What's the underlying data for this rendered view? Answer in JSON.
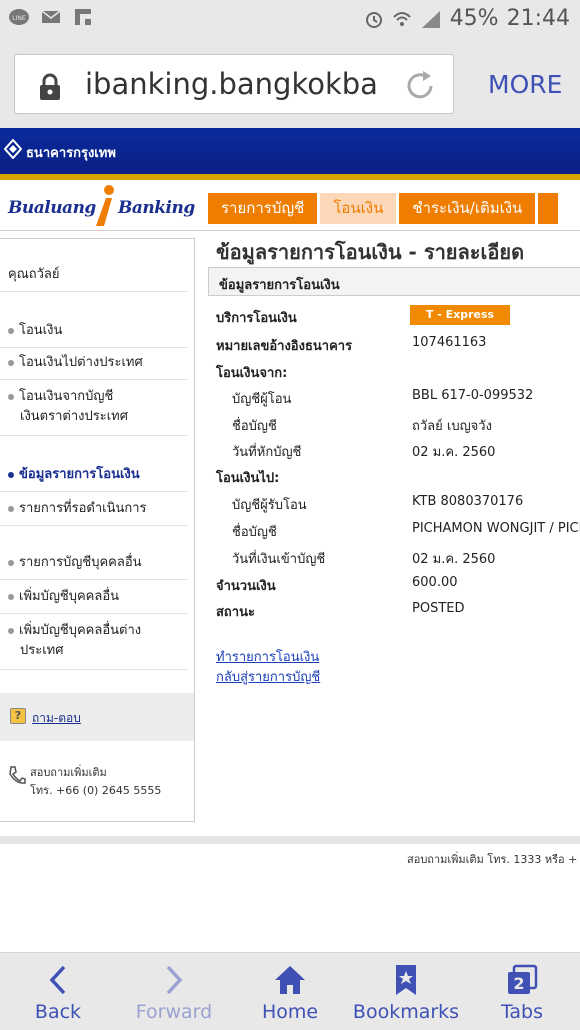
{
  "status": {
    "battery": "45%",
    "time": "21:44"
  },
  "browser": {
    "url": "ibanking.bangkokba",
    "more_label": "MORE"
  },
  "bank": {
    "name": "ธนาคารกรุงเทพ",
    "brand_left": "Bualuang",
    "brand_right": "Banking"
  },
  "tabs": [
    {
      "label": "รายการบัญชี"
    },
    {
      "label": "โอนเงิน"
    },
    {
      "label": "ชำระเงิน/เติมเงิน"
    }
  ],
  "sidebar": {
    "user": "คุณถวัลย์",
    "items": [
      {
        "label": "โอนเงิน"
      },
      {
        "label": "โอนเงินไปต่างประเทศ"
      },
      {
        "line1": "โอนเงินจากบัญชี",
        "line2": "เงินตราต่างประเทศ"
      },
      {
        "label": "ข้อมูลรายการโอนเงิน"
      },
      {
        "label": "รายการที่รอดำเนินการ"
      },
      {
        "label": "รายการบัญชีบุคคลอื่น"
      },
      {
        "label": "เพิ่มบัญชีบุคคลอื่น"
      },
      {
        "line1": "เพิ่มบัญชีบุคคลอื่นต่าง",
        "line2": "ประเทศ"
      }
    ],
    "qa_label": "ถาม-ตอบ",
    "contact_line1": "สอบถามเพิ่มเติม",
    "contact_line2": "โทร. +66 (0) 2645 5555"
  },
  "main": {
    "title": "ข้อมูลรายการโอนเงิน - รายละเอียด",
    "section_title": "ข้อมูลรายการโอนเงิน",
    "service_label": "บริการโอนเงิน",
    "service_value": "T - Express",
    "ref_label": "หมายเลขอ้างอิงธนาคาร",
    "ref_value": "107461163",
    "from_label": "โอนเงินจาก:",
    "from_account_label": "บัญชีผู้โอน",
    "from_account_value": "BBL 617-0-099532",
    "from_name_label": "ชื่อบัญชี",
    "from_name_value": "ถวัลย์ เบญจวัง",
    "debit_date_label": "วันที่หักบัญชี",
    "debit_date_value": "02 ม.ค. 2560",
    "to_label": "โอนเงินไป:",
    "to_account_label": "บัญชีผู้รับโอน",
    "to_account_value": "KTB 8080370176",
    "to_name_label": "ชื่อบัญชี",
    "to_name_value": "PICHAMON WONGJIT / PICH",
    "credit_date_label": "วันที่เงินเข้าบัญชี",
    "credit_date_value": "02 ม.ค. 2560",
    "amount_label": "จำนวนเงิน",
    "amount_value": "600.00",
    "status_label": "สถานะ",
    "status_value": "POSTED",
    "link_transfer": "ทำรายการโอนเงิน",
    "link_back": "กลับสู่รายการบัญชี"
  },
  "footer_text": "สอบถามเพิ่มเติม โทร. 1333 หรือ +",
  "bottom_nav": {
    "back": "Back",
    "forward": "Forward",
    "home": "Home",
    "bookmarks": "Bookmarks",
    "tabs": "Tabs",
    "tab_count": "2"
  },
  "colors": {
    "accent": "#3f51b5",
    "bank_blue": "#0b1f85",
    "tab_orange": "#ef7d00"
  }
}
